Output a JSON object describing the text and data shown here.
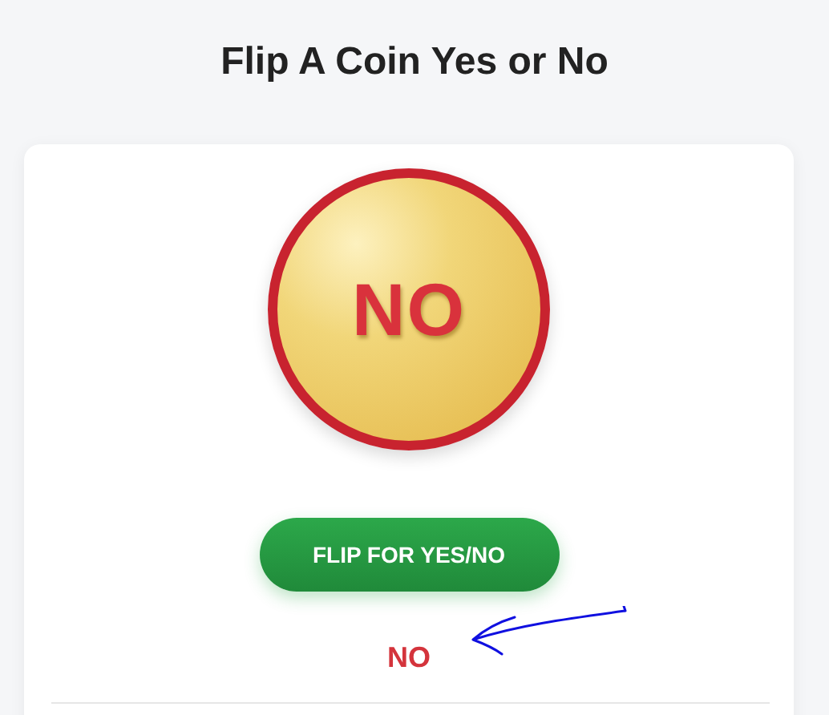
{
  "title": "Flip A Coin Yes or No",
  "coin": {
    "face": "NO"
  },
  "button": {
    "label": "FLIP FOR YES/NO"
  },
  "result": "NO"
}
